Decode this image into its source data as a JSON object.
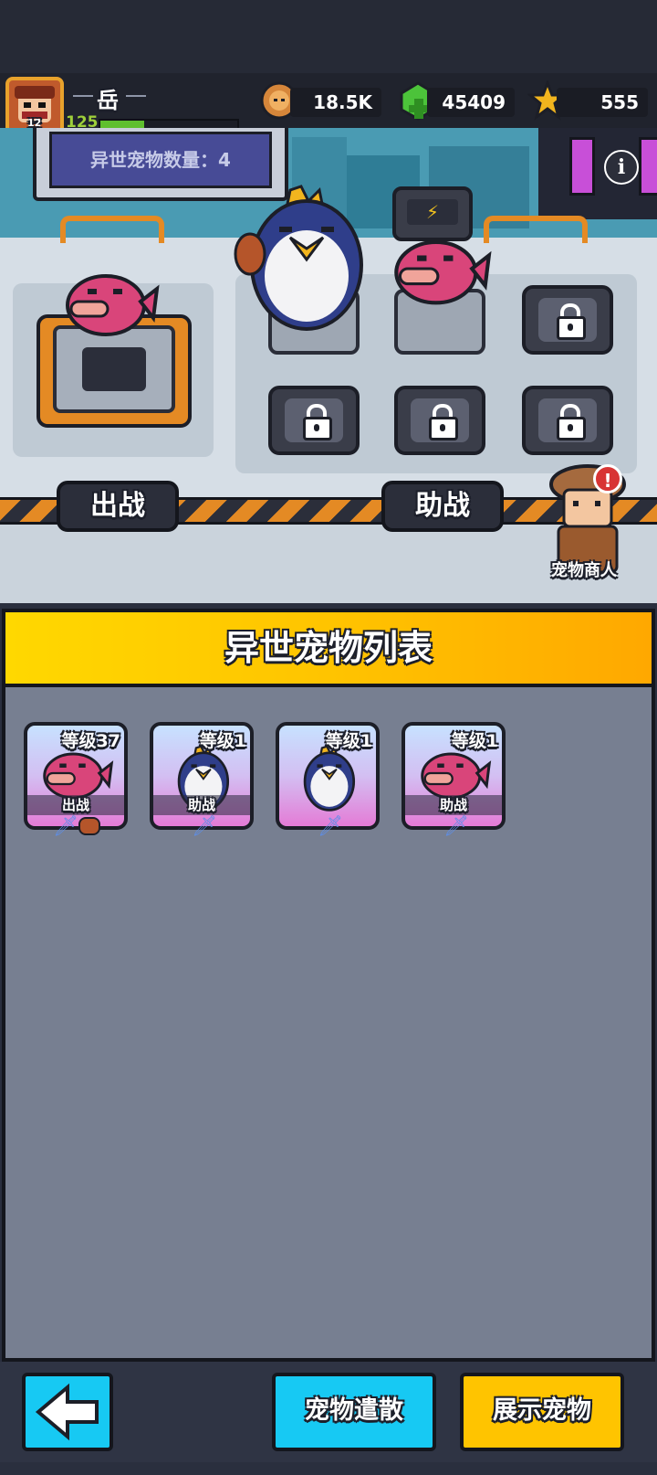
{
  "hud": {
    "player_name": "岳",
    "player_level": "125",
    "rank_badge": "12",
    "resources": [
      {
        "icon": "lion-coin-icon",
        "value": "18.5K"
      },
      {
        "icon": "green-gem-plus-icon",
        "value": "45409"
      },
      {
        "icon": "gold-star-icon",
        "value": "555"
      }
    ]
  },
  "scene": {
    "pet_count_label": "异世宠物数量：4",
    "battle_label": "出战",
    "assist_label": "助战",
    "merchant_label": "宠物商人",
    "merchant_alert": "!"
  },
  "pet_list": {
    "title": "异世宠物列表",
    "pets": [
      {
        "name": "pink-fish",
        "level": "等级37",
        "role": "出战"
      },
      {
        "name": "king-penguin",
        "level": "等级1",
        "role": "助战"
      },
      {
        "name": "king-penguin",
        "level": "等级1",
        "role": ""
      },
      {
        "name": "pink-fish",
        "level": "等级1",
        "role": "助战"
      }
    ]
  },
  "bottom": {
    "back_icon": "left-arrow-icon",
    "release_label": "宠物遣散",
    "show_label": "展示宠物"
  },
  "colors": {
    "accent_yellow": "#ffc400",
    "accent_cyan": "#17c9f3",
    "panel_gray": "#777f91"
  }
}
